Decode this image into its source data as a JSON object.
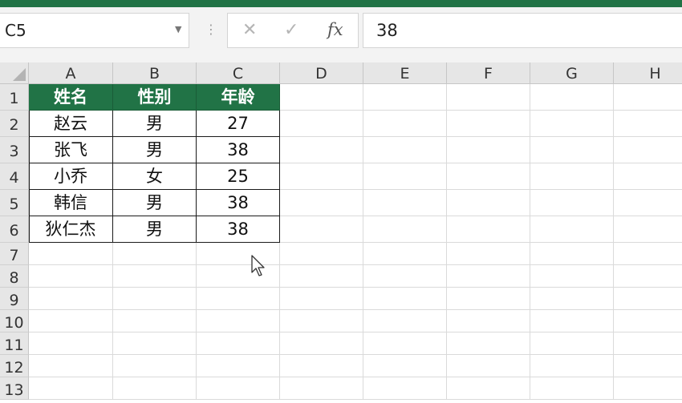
{
  "name_box": {
    "value": "C5"
  },
  "formula_bar": {
    "cancel_icon": "✕",
    "enter_icon": "✓",
    "fx_label": "fx",
    "value": "38"
  },
  "columns": [
    "A",
    "B",
    "C",
    "D",
    "E",
    "F",
    "G",
    "H"
  ],
  "rows": [
    "1",
    "2",
    "3",
    "4",
    "5",
    "6",
    "7",
    "8",
    "9",
    "10",
    "11",
    "12",
    "13"
  ],
  "table": {
    "headers": [
      "姓名",
      "性别",
      "年龄"
    ],
    "rows": [
      [
        "赵云",
        "男",
        "27"
      ],
      [
        "张飞",
        "男",
        "38"
      ],
      [
        "小乔",
        "女",
        "25"
      ],
      [
        "韩信",
        "男",
        "38"
      ],
      [
        "狄仁杰",
        "男",
        "38"
      ]
    ]
  },
  "colors": {
    "accent": "#217346"
  }
}
